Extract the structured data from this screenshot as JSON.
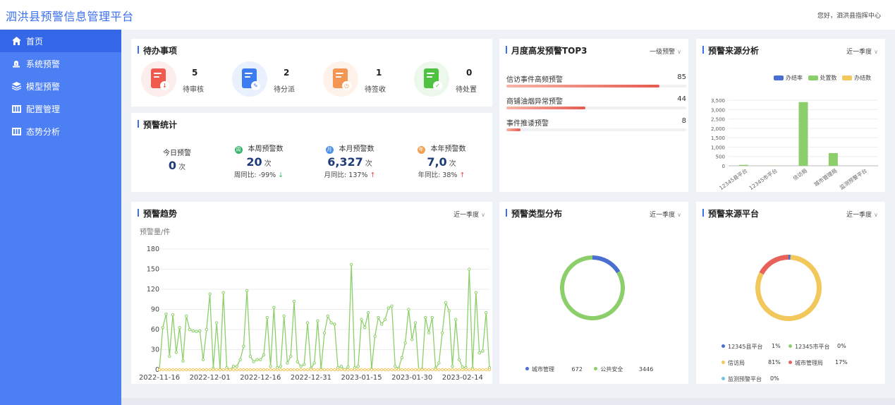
{
  "header": {
    "title": "泗洪县预警信息管理平台",
    "greeting": "您好，泗洪县指挥中心"
  },
  "sidebar": {
    "items": [
      {
        "label": "首页",
        "icon": "home-icon",
        "active": true
      },
      {
        "label": "系统预警",
        "icon": "alarm-icon",
        "active": false
      },
      {
        "label": "模型预警",
        "icon": "layers-icon",
        "active": false
      },
      {
        "label": "配置管理",
        "icon": "config-icon",
        "active": false
      },
      {
        "label": "态势分析",
        "icon": "analysis-icon",
        "active": false
      }
    ]
  },
  "todo": {
    "title": "待办事项",
    "items": [
      {
        "label": "待审核",
        "count": "5",
        "color": "#ef5b4f",
        "bg": "#fdeeed"
      },
      {
        "label": "待分派",
        "count": "2",
        "color": "#3d7bf1",
        "bg": "#eaf1fe"
      },
      {
        "label": "待签收",
        "count": "1",
        "color": "#f39654",
        "bg": "#fef2ea"
      },
      {
        "label": "待处置",
        "count": "0",
        "color": "#4fc242",
        "bg": "#ecf8eb"
      }
    ]
  },
  "stats": {
    "title": "预警统计",
    "today": {
      "label": "今日预警",
      "value": "0",
      "unit": "次"
    },
    "week": {
      "badge": "周",
      "label": "本周预警数",
      "value": "20",
      "unit": "次",
      "compare_label": "周同比:",
      "compare_value": "-99%",
      "trend": "down",
      "color": "#3bb36b"
    },
    "month": {
      "badge": "月",
      "label": "本月预警数",
      "value": "6,327",
      "unit": "次",
      "compare_label": "月同比:",
      "compare_value": "137%",
      "trend": "up",
      "color": "#4a8fe8"
    },
    "year": {
      "badge": "年",
      "label": "本年预警数",
      "value": "7,0",
      "unit": "次",
      "compare_label": "年同比:",
      "compare_value": "38%",
      "trend": "up",
      "color": "#f0a050"
    }
  },
  "top3": {
    "title": "月度高发预警TOP3",
    "filter": "一级预警",
    "items": [
      {
        "name": "信访事件高频预警",
        "value": 85
      },
      {
        "name": "商铺油烟异常预警",
        "value": 44
      },
      {
        "name": "事件推诿预警",
        "value": 8
      }
    ]
  },
  "source_analysis": {
    "title": "预警来源分析",
    "filter": "近一季度",
    "colors": [
      "#4a6fd1",
      "#8ccf6a",
      "#f2c75c"
    ]
  },
  "trend": {
    "title": "预警趋势",
    "filter": "近一季度"
  },
  "type_dist": {
    "title": "预警类型分布",
    "filter": "近一季度",
    "items": [
      {
        "name": "城市管理",
        "value": "672",
        "color": "#4a6fd1"
      },
      {
        "name": "公共安全",
        "value": "3446",
        "color": "#8ccf6a"
      }
    ]
  },
  "platform": {
    "title": "预警来源平台",
    "filter": "近一季度",
    "items": [
      {
        "name": "12345县平台",
        "pct": "1%",
        "color": "#4a6fd1"
      },
      {
        "name": "12345市平台",
        "pct": "0%",
        "color": "#8ccf6a"
      },
      {
        "name": "信访局",
        "pct": "81%",
        "color": "#f2c75c"
      },
      {
        "name": "城市管理局",
        "pct": "17%",
        "color": "#e8625b"
      },
      {
        "name": "监测预警平台",
        "pct": "0%",
        "color": "#6fc4e6"
      }
    ]
  },
  "chart_data": [
    {
      "type": "bar",
      "categories": [
        "12345县平台",
        "12345市平台",
        "信访局",
        "城市管理局",
        "监测预警平台"
      ],
      "series": [
        {
          "name": "办结率",
          "values": [
            0,
            0,
            0,
            0,
            0
          ]
        },
        {
          "name": "处置数",
          "values": [
            50,
            10,
            3400,
            680,
            0
          ]
        },
        {
          "name": "办结数",
          "values": [
            0,
            0,
            0,
            0,
            0
          ]
        }
      ],
      "ylim": [
        0,
        3500
      ],
      "yticks": [
        "0",
        "500",
        "1,000",
        "1,500",
        "2,000",
        "2,500",
        "3,000",
        "3,500"
      ],
      "legend": "top-right"
    },
    {
      "type": "line",
      "ylabel": "预警量/件",
      "ylim": [
        0,
        180
      ],
      "yticks": [
        0,
        30,
        60,
        90,
        120,
        150,
        180
      ],
      "xticks": [
        "2022-11-16",
        "2022-12-01",
        "2022-12-16",
        "2022-12-31",
        "2023-01-15",
        "2023-01-30",
        "2023-02-14"
      ],
      "x_start": "2022-11-16",
      "series": [
        {
          "values": [
            0,
            63,
            83,
            20,
            82,
            26,
            63,
            13,
            80,
            60,
            58,
            57,
            58,
            15,
            60,
            113,
            2,
            70,
            1,
            115,
            3,
            0,
            5,
            5,
            15,
            35,
            118,
            20,
            12,
            15,
            15,
            22,
            78,
            5,
            93,
            3,
            5,
            80,
            10,
            20,
            102,
            12,
            5,
            8,
            70,
            2,
            10,
            73,
            1,
            55,
            80,
            70,
            68,
            3,
            5,
            0,
            4,
            157,
            3,
            5,
            75,
            63,
            85,
            1,
            50,
            78,
            68,
            75,
            92,
            95,
            5,
            2,
            18,
            40,
            90,
            45,
            70,
            0,
            1,
            78,
            55,
            78,
            2,
            10,
            55,
            100,
            88,
            5,
            75,
            15,
            4,
            3,
            150,
            2,
            115,
            25,
            28,
            85,
            3
          ]
        },
        {
          "values": [
            0,
            0,
            0,
            0,
            0,
            0,
            0,
            0,
            0,
            0,
            0,
            0,
            0,
            0,
            0,
            0,
            0,
            0,
            0,
            0,
            0,
            0,
            0,
            0,
            0,
            0,
            0,
            0,
            0,
            0,
            0,
            0,
            0,
            0,
            0,
            0,
            0,
            0,
            0,
            0,
            0,
            0,
            0,
            0,
            0,
            0,
            0,
            0,
            0,
            0,
            0,
            0,
            0,
            0,
            0,
            0,
            0,
            0,
            0,
            0,
            0,
            0,
            0,
            0,
            0,
            0,
            0,
            0,
            0,
            0,
            0,
            0,
            0,
            0,
            0,
            0,
            0,
            0,
            0,
            0,
            0,
            0,
            0,
            0,
            0,
            0,
            0,
            0,
            0,
            0,
            0,
            0,
            0,
            0,
            0,
            0,
            0,
            0,
            0
          ]
        }
      ]
    },
    {
      "type": "pie",
      "categories": [
        "城市管理",
        "公共安全"
      ],
      "values": [
        672,
        3446
      ]
    },
    {
      "type": "pie",
      "categories": [
        "12345县平台",
        "12345市平台",
        "信访局",
        "城市管理局",
        "监测预警平台"
      ],
      "values": [
        1,
        0,
        81,
        17,
        0
      ]
    }
  ]
}
